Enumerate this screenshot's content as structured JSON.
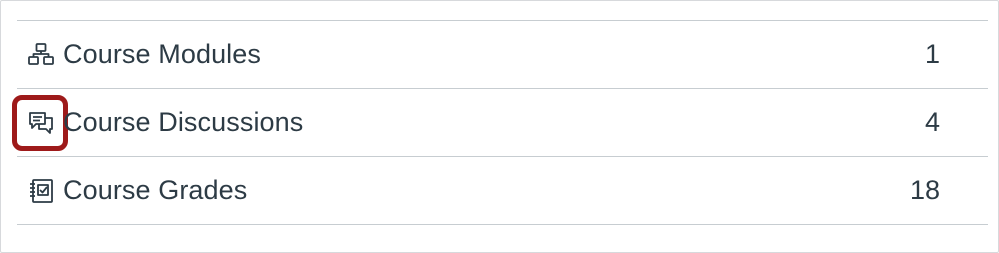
{
  "items": [
    {
      "label": "Course Modules",
      "count": "1",
      "icon": "modules-icon"
    },
    {
      "label": "Course Discussions",
      "count": "4",
      "icon": "discussions-icon",
      "highlighted": true
    },
    {
      "label": "Course Grades",
      "count": "18",
      "icon": "grades-icon"
    }
  ],
  "colors": {
    "text": "#2d3b45",
    "divider": "#c7cdd1",
    "highlight": "#9e1a1a"
  }
}
